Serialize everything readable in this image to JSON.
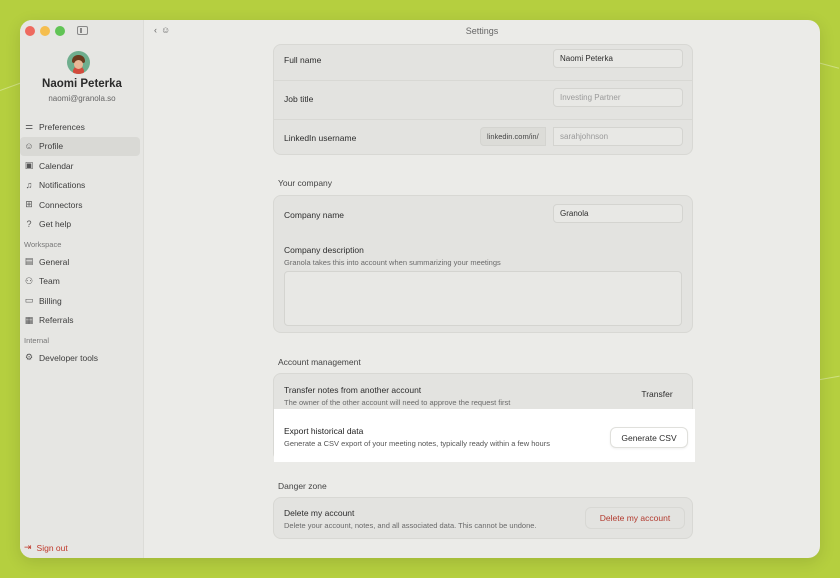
{
  "window": {
    "title": "Settings"
  },
  "user": {
    "name": "Naomi Peterka",
    "email": "naomi@granola.so"
  },
  "sidebar": {
    "items": [
      {
        "label": "Preferences",
        "icon": "sliders-icon"
      },
      {
        "label": "Profile",
        "icon": "person-icon",
        "active": true
      },
      {
        "label": "Calendar",
        "icon": "calendar-icon"
      },
      {
        "label": "Notifications",
        "icon": "bell-icon"
      },
      {
        "label": "Connectors",
        "icon": "grid-icon"
      },
      {
        "label": "Get help",
        "icon": "help-icon"
      }
    ],
    "workspace_label": "Workspace",
    "workspace_items": [
      {
        "label": "General",
        "icon": "building-icon"
      },
      {
        "label": "Team",
        "icon": "team-icon"
      },
      {
        "label": "Billing",
        "icon": "card-icon"
      },
      {
        "label": "Referrals",
        "icon": "gift-icon"
      }
    ],
    "internal_label": "Internal",
    "internal_items": [
      {
        "label": "Developer tools",
        "icon": "gear-icon"
      }
    ],
    "sign_out": "Sign out"
  },
  "profile": {
    "full_name_label": "Full name",
    "full_name_value": "Naomi Peterka",
    "job_title_label": "Job title",
    "job_title_placeholder": "Investing Partner",
    "linkedin_label": "LinkedIn username",
    "linkedin_prefix": "linkedin.com/in/",
    "linkedin_placeholder": "sarahjohnson"
  },
  "company": {
    "section_title": "Your company",
    "name_label": "Company name",
    "name_value": "Granola",
    "description_label": "Company description",
    "description_sub": "Granola takes this into account when summarizing your meetings"
  },
  "account": {
    "section_title": "Account management",
    "transfer_label": "Transfer notes from another account",
    "transfer_sub": "The owner of the other account will need to approve the request first",
    "transfer_button": "Transfer",
    "export_label": "Export historical data",
    "export_sub": "Generate a CSV export of your meeting notes, typically ready within a few hours",
    "export_button": "Generate CSV"
  },
  "danger": {
    "section_title": "Danger zone",
    "delete_label": "Delete my account",
    "delete_sub": "Delete your account, notes, and all associated data. This cannot be undone.",
    "delete_button": "Delete my account"
  }
}
